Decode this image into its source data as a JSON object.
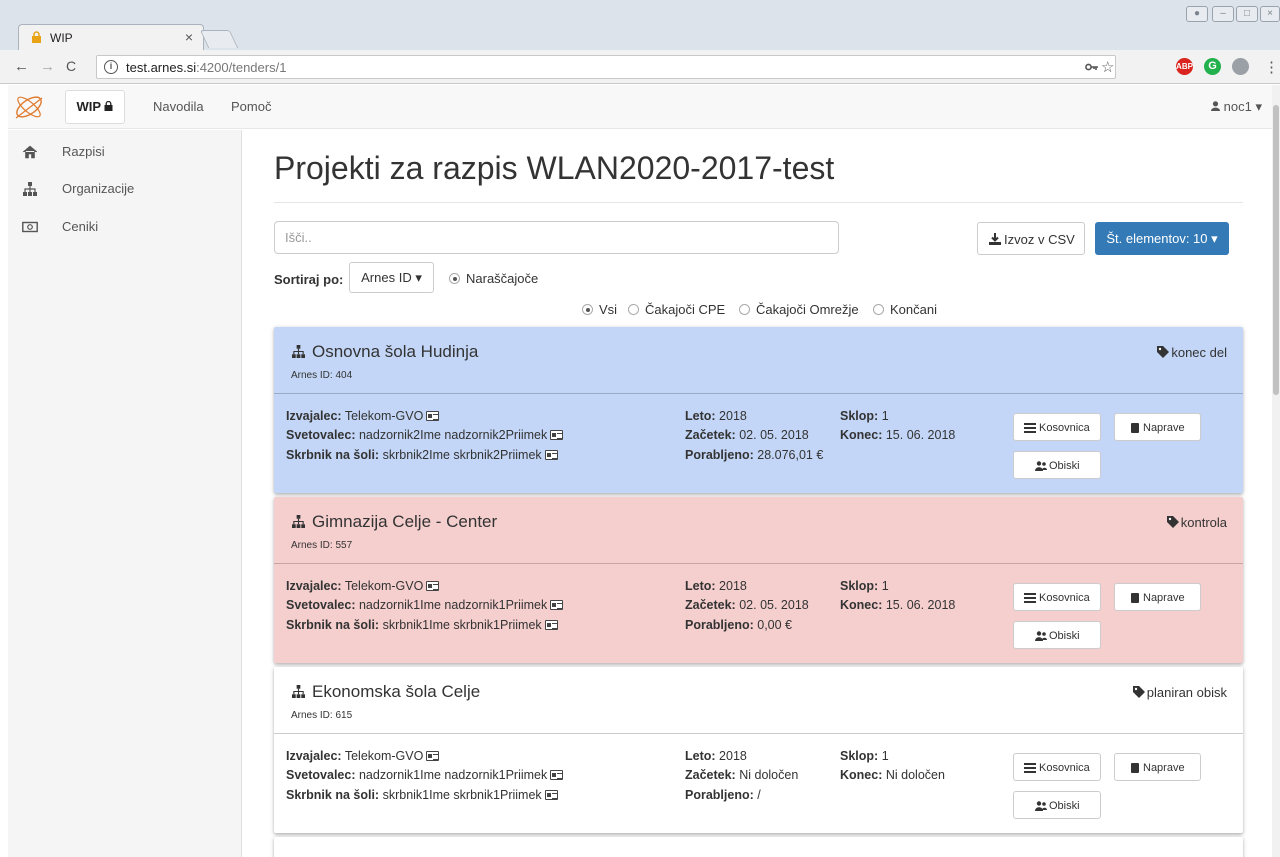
{
  "browser": {
    "tab_title": "WIP",
    "tab_close": "×",
    "url_host": "test.arnes.si",
    "url_rest": ":4200/tenders/1",
    "ext_abp": "ABP"
  },
  "nav": {
    "wip_label": "WIP",
    "links": [
      "Navodila",
      "Pomoč"
    ],
    "user": "noc1"
  },
  "sidebar": {
    "items": [
      {
        "label": "Razpisi",
        "icon": "home-icon"
      },
      {
        "label": "Organizacije",
        "icon": "sitemap-icon"
      },
      {
        "label": "Ceniki",
        "icon": "money-icon"
      }
    ]
  },
  "main": {
    "title": "Projekti za razpis WLAN2020-2017-test",
    "search_placeholder": "Išči..",
    "csv_label": "Izvoz v CSV",
    "count_label": "Št. elementov: 10",
    "sort_label": "Sortiraj po:",
    "sort_value": "Arnes ID",
    "order_label": "Naraščajoče",
    "filters": [
      "Vsi",
      "Čakajoči CPE",
      "Čakajoči Omrežje",
      "Končani"
    ]
  },
  "labels": {
    "contractor": "Izvajalec:",
    "advisor": "Svetovalec:",
    "custodian": "Skrbnik na šoli:",
    "year": "Leto:",
    "start": "Začetek:",
    "spent": "Porabljeno:",
    "lot": "Sklop:",
    "end": "Konec:",
    "btn_kosovnica": "Kosovnica",
    "btn_naprave": "Naprave",
    "btn_obiski": "Obiski"
  },
  "cards": [
    {
      "name": "Osnovna šola Hudinja",
      "arnes": "Arnes ID: 404",
      "status": "konec del",
      "contractor": "Telekom-GVO",
      "advisor": "nadzornik2Ime nadzornik2Priimek",
      "custodian": "skrbnik2Ime skrbnik2Priimek",
      "year": "2018",
      "start": "02. 05. 2018",
      "spent": "28.076,01 €",
      "lot": "1",
      "end": "15. 06. 2018",
      "color": "#c3d6f7"
    },
    {
      "name": "Gimnazija Celje - Center",
      "arnes": "Arnes ID: 557",
      "status": "kontrola",
      "contractor": "Telekom-GVO",
      "advisor": "nadzornik1Ime nadzornik1Priimek",
      "custodian": "skrbnik1Ime skrbnik1Priimek",
      "year": "2018",
      "start": "02. 05. 2018",
      "spent": "0,00 €",
      "lot": "1",
      "end": "15. 06. 2018",
      "color": "#f5cece"
    },
    {
      "name": "Ekonomska šola Celje",
      "arnes": "Arnes ID: 615",
      "status": "planiran obisk",
      "contractor": "Telekom-GVO",
      "advisor": "nadzornik1Ime nadzornik1Priimek",
      "custodian": "skrbnik1Ime skrbnik1Priimek",
      "year": "2018",
      "start": "Ni določen",
      "spent": "/",
      "lot": "1",
      "end": "Ni določen",
      "color": "#ffffff"
    }
  ]
}
